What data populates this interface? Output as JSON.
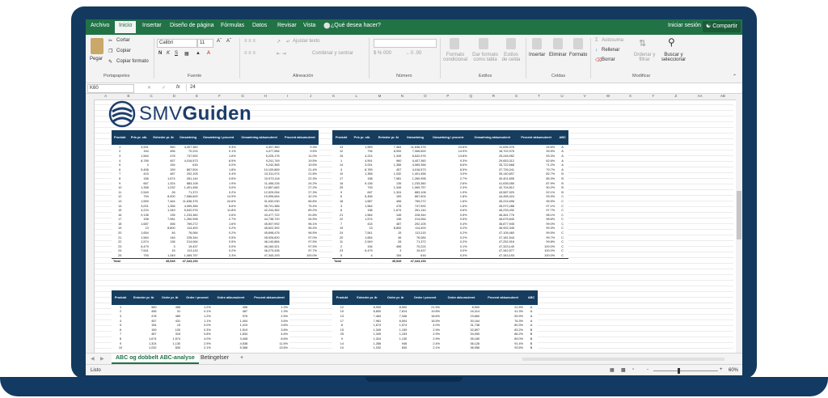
{
  "menu": {
    "tabs": [
      "Archivo",
      "Inicio",
      "Insertar",
      "Diseño de página",
      "Fórmulas",
      "Datos",
      "Revisar",
      "Vista"
    ],
    "tell_me": "¿Qué desea hacer?",
    "signin": "Iniciar sesión",
    "share": "Compartir"
  },
  "ribbon": {
    "paste": "Pegar",
    "cut": "Cortar",
    "copy": "Copiar",
    "format_painter": "Copiar formato",
    "clipboard_label": "Portapapeles",
    "font_name": "Calibri",
    "font_size": "11",
    "bold": "N",
    "italic": "K",
    "underline": "S",
    "font_label": "Fuente",
    "wrap_text": "Ajustar texto",
    "merge_center": "Combinar y centrar",
    "alignment_label": "Alineación",
    "number_label": "Número",
    "conditional_format": "Formato condicional",
    "format_as_table": "Dar formato como tabla",
    "cell_styles": "Estilos de celda",
    "styles_label": "Estilos",
    "insert": "Insertar",
    "delete": "Eliminar",
    "format": "Formato",
    "cells_label": "Celdas",
    "autosum": "Autosuma",
    "fill": "Rellenar",
    "clear": "Borrar",
    "sort_filter": "Ordenar y filtrar",
    "find_select": "Buscar y seleccionar",
    "editing_label": "Modificar"
  },
  "formula_bar": {
    "name_box": "K60",
    "fx": "fx",
    "value": "24"
  },
  "columns": [
    "A",
    "B",
    "C",
    "D",
    "E",
    "F",
    "G",
    "H",
    "I",
    "J",
    "K",
    "L",
    "M",
    "N",
    "O",
    "P",
    "Q",
    "R",
    "S",
    "T",
    "U",
    "V",
    "W",
    "X",
    "Y",
    "Z",
    "AA",
    "AB"
  ],
  "logo": {
    "light": "SMV",
    "bold": "Guiden"
  },
  "table1": {
    "headers": [
      "Produkt",
      "Pris pr. stk.",
      "Enheder pr. år",
      "Omsætning",
      "Omsætning i procent",
      "Omsætning akkumuleret",
      "Procent akkumuleret"
    ],
    "rows": [
      [
        "1",
        "4,591",
        "960",
        "4,407,360",
        "9.3%",
        "4,407,360",
        "9.3%"
      ],
      [
        "2",
        "154",
        "456",
        "70,224",
        "0.1%",
        "4,477,584",
        "9.5%"
      ],
      [
        "3",
        "1,564",
        "478",
        "747,592",
        "1.6%",
        "5,225,176",
        "11.0%"
      ],
      [
        "4",
        "8,789",
        "457",
        "4,016,573",
        "8.5%",
        "9,241,749",
        "19.5%"
      ],
      [
        "5",
        "4",
        "154",
        "616",
        "0.0%",
        "9,242,365",
        "19.5%"
      ],
      [
        "6",
        "5,456",
        "159",
        "867,504",
        "1.8%",
        "10,109,869",
        "21.4%"
      ],
      [
        "7",
        "415",
        "487",
        "202,105",
        "0.4%",
        "10,311,974",
        "21.8%"
      ],
      [
        "8",
        "156",
        "1,674",
        "261,144",
        "0.6%",
        "10,573,118",
        "22.3%"
      ],
      [
        "9",
        "667",
        "1,324",
        "883,108",
        "1.9%",
        "11,456,226",
        "24.2%"
      ],
      [
        "10",
        "1,358",
        "1,032",
        "1,401,456",
        "3.0%",
        "12,857,682",
        "27.2%"
      ],
      [
        "11",
        "2,549",
        "28",
        "71,372",
        "0.2%",
        "12,929,054",
        "27.3%"
      ],
      [
        "12",
        "794",
        "8,900",
        "7,066,600",
        "14.9%",
        "19,995,654",
        "42.2%"
      ],
      [
        "13",
        "1,559",
        "7,464",
        "11,636,376",
        "24.6%",
        "31,632,030",
        "66.8%"
      ],
      [
        "14",
        "3,001",
        "1,356",
        "4,069,356",
        "8.6%",
        "35,701,386",
        "75.4%"
      ],
      [
        "15",
        "4,224",
        "1,349",
        "5,542,976",
        "11.8%",
        "42,244,362",
        "89.2%"
      ],
      [
        "16",
        "9,136",
        "135",
        "1,233,360",
        "2.6%",
        "43,477,722",
        "91.8%"
      ],
      [
        "17",
        "158",
        "7,981",
        "1,260,998",
        "2.7%",
        "44,738,720",
        "94.5%"
      ],
      [
        "18",
        "1,687",
        "456",
        "769,272",
        "1.6%",
        "45,507,992",
        "96.1%"
      ],
      [
        "19",
        "13",
        "8,800",
        "114,400",
        "0.2%",
        "45,622,392",
        "96.4%"
      ],
      [
        "20",
        "1,654",
        "46",
        "76,084",
        "0.2%",
        "45,698,476",
        "96.5%"
      ],
      [
        "21",
        "1,564",
        "146",
        "228,344",
        "0.5%",
        "45,926,820",
        "97.0%"
      ],
      [
        "22",
        "1,574",
        "136",
        "214,064",
        "0.5%",
        "46,140,884",
        "97.5%"
      ],
      [
        "23",
        "6,479",
        "3",
        "19,437",
        "0.0%",
        "46,160,321",
        "97.5%"
      ],
      [
        "24",
        "7,541",
        "15",
        "113,115",
        "0.2%",
        "46,273,436",
        "97.7%"
      ],
      [
        "25",
        "793",
        "1,349",
        "1,069,757",
        "2.3%",
        "47,343,193",
        "100.0%"
      ]
    ],
    "total": [
      "Total",
      "",
      "45,545",
      "47,343,193",
      "",
      "",
      ""
    ]
  },
  "table2": {
    "headers": [
      "Produkt",
      "Pris pr. stk.",
      "Enheder pr. år",
      "Omsætning",
      "Omsætning i procent",
      "Omsætning akkumuleret",
      "Procent akkumuleret",
      "ABC"
    ],
    "rows": [
      [
        "13",
        "1,559",
        "7,464",
        "11,636,376",
        "24.6%",
        "11,636,376",
        "24.6%",
        "A"
      ],
      [
        "12",
        "794",
        "8,900",
        "7,066,600",
        "14.9%",
        "18,702,976",
        "39.5%",
        "A"
      ],
      [
        "15",
        "4,224",
        "1,349",
        "6,542,976",
        "13.8%",
        "25,245,952",
        "53.3%",
        "A"
      ],
      [
        "1",
        "4,591",
        "960",
        "4,407,360",
        "9.3%",
        "29,653,312",
        "62.6%",
        "A"
      ],
      [
        "14",
        "3,001",
        "1,356",
        "4,069,356",
        "8.6%",
        "33,722,668",
        "71.2%",
        "A"
      ],
      [
        "4",
        "8,789",
        "457",
        "4,016,573",
        "8.5%",
        "37,739,241",
        "79.7%",
        "A"
      ],
      [
        "10",
        "1,358",
        "1,032",
        "1,401,456",
        "3.0%",
        "39,140,697",
        "82.7%",
        "B"
      ],
      [
        "17",
        "158",
        "7,981",
        "1,260,998",
        "2.7%",
        "40,401,695",
        "85.3%",
        "B"
      ],
      [
        "16",
        "9,136",
        "135",
        "1,233,360",
        "2.6%",
        "41,635,055",
        "87.9%",
        "B"
      ],
      [
        "25",
        "793",
        "1,349",
        "1,069,757",
        "2.3%",
        "42,704,812",
        "90.2%",
        "B"
      ],
      [
        "9",
        "667",
        "1,324",
        "883,108",
        "1.9%",
        "43,587,920",
        "92.1%",
        "B"
      ],
      [
        "6",
        "5,456",
        "159",
        "867,504",
        "1.8%",
        "44,455,424",
        "93.9%",
        "C"
      ],
      [
        "18",
        "1,687",
        "456",
        "769,272",
        "1.6%",
        "45,224,696",
        "95.5%",
        "C"
      ],
      [
        "3",
        "1,564",
        "478",
        "747,592",
        "1.6%",
        "45,972,288",
        "97.1%",
        "C"
      ],
      [
        "8",
        "156",
        "1,674",
        "261,144",
        "0.6%",
        "46,233,432",
        "97.7%",
        "C"
      ],
      [
        "21",
        "1,564",
        "146",
        "228,344",
        "0.5%",
        "46,461,776",
        "98.1%",
        "C"
      ],
      [
        "22",
        "1,574",
        "136",
        "214,064",
        "0.5%",
        "46,675,840",
        "98.6%",
        "C"
      ],
      [
        "7",
        "415",
        "487",
        "202,105",
        "0.4%",
        "46,877,945",
        "99.0%",
        "C"
      ],
      [
        "19",
        "13",
        "8,800",
        "114,400",
        "0.2%",
        "46,992,345",
        "99.3%",
        "C"
      ],
      [
        "24",
        "7,541",
        "15",
        "113,115",
        "0.2%",
        "47,105,460",
        "99.5%",
        "C"
      ],
      [
        "20",
        "1,654",
        "46",
        "76,084",
        "0.2%",
        "47,181,544",
        "99.7%",
        "C"
      ],
      [
        "11",
        "2,549",
        "28",
        "71,372",
        "0.2%",
        "47,252,916",
        "99.8%",
        "C"
      ],
      [
        "2",
        "154",
        "456",
        "70,224",
        "0.1%",
        "47,323,140",
        "100.0%",
        "C"
      ],
      [
        "23",
        "6,479",
        "3",
        "19,437",
        "0.0%",
        "47,342,577",
        "100.0%",
        "C"
      ],
      [
        "5",
        "4",
        "154",
        "616",
        "0.0%",
        "47,343,193",
        "100.0%",
        "C"
      ]
    ],
    "total": [
      "Total",
      "",
      "45,545",
      "47,343,193",
      "",
      "",
      "",
      ""
    ]
  },
  "table3": {
    "headers": [
      "Produkt",
      "Enheder pr. år",
      "Ordre pr. år",
      "Ordre i procent",
      "Ordre akkumuleret",
      "Procent akkumuleret"
    ],
    "rows": [
      [
        "1",
        "960",
        "456",
        "1.2%",
        "456",
        "1.2%"
      ],
      [
        "2",
        "456",
        "31",
        "0.1%",
        "487",
        "1.3%"
      ],
      [
        "3",
        "478",
        "489",
        "1.2%",
        "976",
        "2.5%"
      ],
      [
        "4",
        "457",
        "431",
        "1.1%",
        "1,404",
        "3.6%"
      ],
      [
        "5",
        "154",
        "15",
        "0.0%",
        "1,419",
        "3.6%"
      ],
      [
        "6",
        "159",
        "100",
        "0.3%",
        "1,519",
        "3.8%"
      ],
      [
        "7",
        "487",
        "315",
        "0.8%",
        "1,834",
        "4.6%"
      ],
      [
        "8",
        "1,674",
        "1,574",
        "4.0%",
        "3,408",
        "8.6%"
      ],
      [
        "9",
        "1,324",
        "1,130",
        "2.9%",
        "4,538",
        "11.5%"
      ],
      [
        "10",
        "1,032",
        "830",
        "2.1%",
        "5,368",
        "13.6%"
      ]
    ]
  },
  "table4": {
    "headers": [
      "Produkt",
      "Enheder pr. år",
      "Ordre pr. år",
      "Ordre i procent",
      "Ordre akkumuleret",
      "Procent akkumuleret",
      "ABC"
    ],
    "rows": [
      [
        "12",
        "8,900",
        "8,500",
        "21.5%",
        "8,500",
        "21.5%",
        "A"
      ],
      [
        "19",
        "8,800",
        "7,814",
        "19.8%",
        "16,314",
        "41.3%",
        "A"
      ],
      [
        "13",
        "7,464",
        "7,346",
        "18.6%",
        "23,660",
        "59.9%",
        "A"
      ],
      [
        "17",
        "7,981",
        "6,504",
        "16.5%",
        "30,164",
        "76.3%",
        "A"
      ],
      [
        "8",
        "1,674",
        "1,574",
        "4.0%",
        "31,738",
        "80.3%",
        "A"
      ],
      [
        "15",
        "1,349",
        "1,159",
        "2.9%",
        "32,897",
        "83.2%",
        "B"
      ],
      [
        "25",
        "1,349",
        "1,153",
        "2.9%",
        "34,050",
        "86.2%",
        "B"
      ],
      [
        "9",
        "1,324",
        "1,130",
        "2.9%",
        "35,180",
        "89.0%",
        "B"
      ],
      [
        "14",
        "1,356",
        "946",
        "2.4%",
        "36,126",
        "91.4%",
        "B"
      ],
      [
        "10",
        "1,032",
        "830",
        "2.1%",
        "36,956",
        "93.5%",
        "B"
      ]
    ]
  },
  "sheets": {
    "active": "ABC og dobbelt ABC-analyse",
    "other": "Betingelser",
    "add": "+"
  },
  "status": {
    "mode": "Listo",
    "zoom": "60%",
    "zoom_minus": "-",
    "zoom_plus": "+"
  }
}
